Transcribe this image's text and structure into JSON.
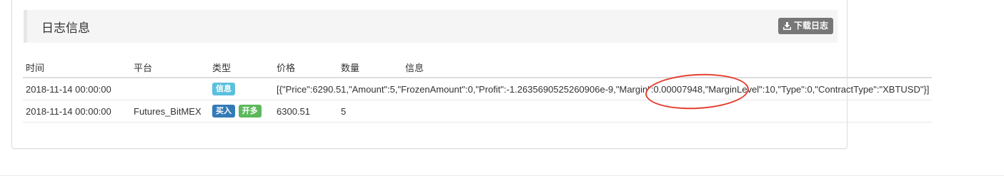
{
  "panel": {
    "title": "日志信息",
    "download_label": "下载日志"
  },
  "table": {
    "headers": [
      "时间",
      "平台",
      "类型",
      "价格",
      "数量",
      "信息"
    ],
    "rows": [
      {
        "time": "2018-11-14 00:00:00",
        "platform": "",
        "badges": [
          "信息"
        ],
        "price": "",
        "amount": "",
        "info": "[{\"Price\":6290.51,\"Amount\":5,\"FrozenAmount\":0,\"Profit\":-1.2635690525260906e-9,\"Margin\":0.00007948,\"MarginLevel\":10,\"Type\":0,\"ContractType\":\"XBTUSD\"}]"
      },
      {
        "time": "2018-11-14 00:00:00",
        "platform": "Futures_BitMEX",
        "badges": [
          "买入",
          "开多"
        ],
        "price": "6300.51",
        "amount": "5",
        "info": ""
      }
    ]
  },
  "colors": {
    "badge_info": "#5bc0de",
    "badge_buy": "#337ab7",
    "badge_open_long": "#5cb85c",
    "annotation_circle": "#e53d2e"
  },
  "icons": {
    "download": "download-icon"
  }
}
